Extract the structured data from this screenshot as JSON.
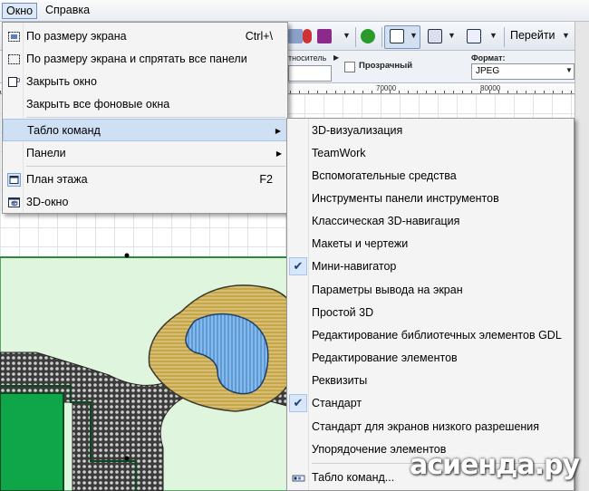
{
  "menubar": {
    "items": [
      {
        "label": "Окно",
        "active": true
      },
      {
        "label": "Справка",
        "active": false
      }
    ]
  },
  "toolbar": {
    "goto_label": "Перейти"
  },
  "infobar": {
    "relative_label": "тноситель",
    "transparent_label": "Прозрачный",
    "format_label": "Формат:",
    "format_value": "JPEG"
  },
  "ruler": {
    "ticks": [
      "70000",
      "80000"
    ]
  },
  "window_menu": {
    "items": [
      {
        "label": "По размеру экрана",
        "shortcut": "Ctrl+\\",
        "icon": "fit-screen-icon"
      },
      {
        "label": "По размеру экрана и спрятать все панели",
        "shortcut": "",
        "icon": "fit-screen-hide-icon"
      },
      {
        "label": "Закрыть окно",
        "shortcut": "",
        "icon": "close-window-icon"
      },
      {
        "label": "Закрыть все фоновые окна",
        "shortcut": "",
        "icon": ""
      },
      {
        "label": "Табло команд",
        "shortcut": "",
        "icon": "",
        "submenu": true,
        "highlighted": true
      },
      {
        "label": "Панели",
        "shortcut": "",
        "icon": "",
        "submenu": true
      },
      {
        "label": "План этажа",
        "shortcut": "F2",
        "icon": "floor-plan-icon"
      },
      {
        "label": "3D-окно",
        "shortcut": "",
        "icon": "3d-window-icon"
      }
    ]
  },
  "toolbars_submenu": {
    "items": [
      {
        "label": "3D-визуализация",
        "checked": false
      },
      {
        "label": "TeamWork",
        "checked": false
      },
      {
        "label": "Вспомогательные средства",
        "checked": false
      },
      {
        "label": "Инструменты панели инструментов",
        "checked": false
      },
      {
        "label": "Классическая 3D-навигация",
        "checked": false
      },
      {
        "label": "Макеты и чертежи",
        "checked": false
      },
      {
        "label": "Мини-навигатор",
        "checked": true
      },
      {
        "label": "Параметры вывода на экран",
        "checked": false
      },
      {
        "label": "Простой 3D",
        "checked": false
      },
      {
        "label": "Редактирование библиотечных элементов GDL",
        "checked": false
      },
      {
        "label": "Редактирование элементов",
        "checked": false
      },
      {
        "label": "Реквизиты",
        "checked": false
      },
      {
        "label": "Стандарт",
        "checked": true
      },
      {
        "label": "Стандарт для экранов низкого разрешения",
        "checked": false
      },
      {
        "label": "Упорядочение элементов",
        "checked": false
      },
      {
        "label": "Табло команд...",
        "checked": false
      }
    ]
  },
  "watermark": "асиенда.ру",
  "colors": {
    "menu_highlight": "#cfe0f5",
    "lawn_green": "#0fa64a",
    "light_green": "#dff5dd",
    "sand": "#c6a64b",
    "water": "#4a8fd0"
  }
}
